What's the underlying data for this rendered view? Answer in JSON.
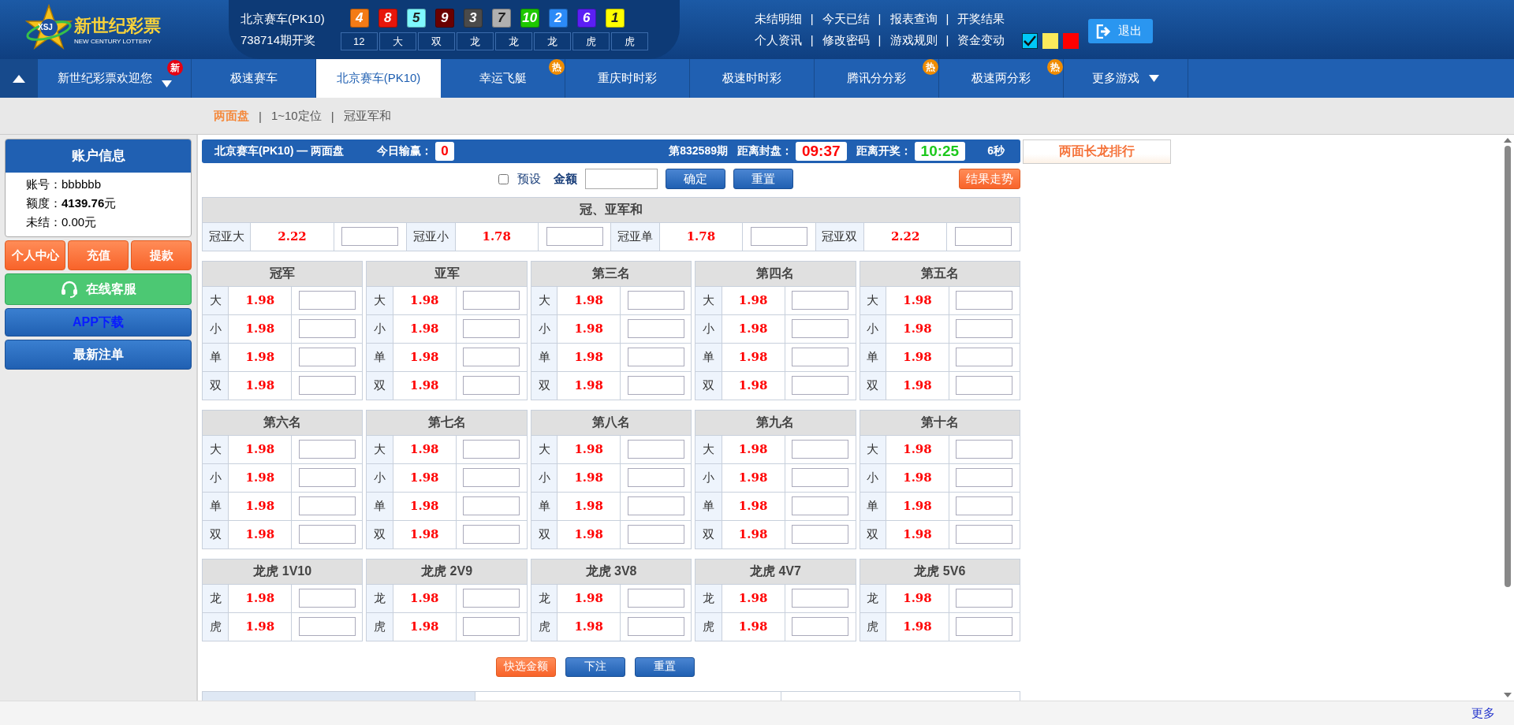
{
  "logo": {
    "title": "新世纪彩票",
    "subtitle": "NEW CENTURY LOTTERY",
    "mark": "XSJ"
  },
  "draw": {
    "game": "北京赛车(PK10)",
    "issue": "738714期开奖",
    "balls": [
      {
        "number": "4",
        "color": "#f47b16"
      },
      {
        "number": "8",
        "color": "#e7160b"
      },
      {
        "number": "5",
        "color": "#7ff8ff"
      },
      {
        "number": "9",
        "color": "#6a0000"
      },
      {
        "number": "3",
        "color": "#4a4a4a"
      },
      {
        "number": "7",
        "color": "#b0b0b0"
      },
      {
        "number": "10",
        "color": "#1ec800"
      },
      {
        "number": "2",
        "color": "#2b8af7"
      },
      {
        "number": "6",
        "color": "#5b1ff5"
      },
      {
        "number": "1",
        "color": "#ffff00"
      }
    ],
    "stats": [
      "12",
      "大",
      "双",
      "龙",
      "龙",
      "龙",
      "虎",
      "虎"
    ]
  },
  "top_links": [
    [
      "未结明细",
      "今天已结",
      "报表查询",
      "开奖结果"
    ],
    [
      "个人资讯",
      "修改密码",
      "游戏规则",
      "资金变动"
    ]
  ],
  "theme_swatches": [
    {
      "color": "#00c8f8",
      "selected": true
    },
    {
      "color": "#fbea5b",
      "selected": false
    },
    {
      "color": "#ff0000",
      "selected": false
    }
  ],
  "link_separator": "|",
  "logout": "退出",
  "nav": [
    {
      "label": "新世纪彩票欢迎您",
      "selected": false,
      "badge": "新",
      "dropdown": true
    },
    {
      "label": "极速赛车",
      "selected": false,
      "dropdown": false
    },
    {
      "label": "北京赛车(PK10)",
      "selected": true,
      "dropdown": false
    },
    {
      "label": "幸运飞艇",
      "selected": false,
      "badge": "热",
      "dropdown": false
    },
    {
      "label": "重庆时时彩",
      "selected": false,
      "dropdown": false
    },
    {
      "label": "极速时时彩",
      "selected": false,
      "dropdown": false
    },
    {
      "label": "腾讯分分彩",
      "selected": false,
      "badge": "热",
      "dropdown": false
    },
    {
      "label": "极速两分彩",
      "selected": false,
      "badge": "热",
      "dropdown": false
    },
    {
      "label": "更多游戏",
      "selected": false,
      "dropdown": true
    }
  ],
  "sub_tab_separator": "|",
  "sub_tabs": [
    {
      "label": "两面盘",
      "selected": true
    },
    {
      "label": "1~10定位",
      "selected": false
    },
    {
      "label": "冠亚军和",
      "selected": false
    }
  ],
  "account": {
    "title": "账户信息",
    "fields": [
      {
        "label": "账号：",
        "value": "bbbbbb",
        "bold": false
      },
      {
        "label": "额度：",
        "value": "4139.76",
        "unit": "元",
        "bold": true
      },
      {
        "label": "未结：",
        "value": "0.00",
        "unit": "元",
        "bold": false
      }
    ]
  },
  "account_buttons": [
    "个人中心",
    "充值",
    "提款"
  ],
  "side_buttons": [
    {
      "label": "在线客服",
      "kind": "green"
    },
    {
      "label": "APP下载",
      "kind": "app"
    },
    {
      "label": "最新注单",
      "kind": "blue"
    }
  ],
  "info_bar": {
    "title": "北京赛车(PK10) — 两面盘",
    "profit_label": "今日输赢：",
    "profit": "0",
    "period": "第832589期",
    "close_label": "距离封盘：",
    "close": "09:37",
    "open_label": "距离开奖：",
    "open": "10:25",
    "refresh": "6秒"
  },
  "ranking": "两面长龙排行",
  "controls": {
    "preset": {
      "label": "预设",
      "checked": false
    },
    "amount_label": "金额",
    "confirm": "确定",
    "reset": "重置",
    "trend": "结果走势"
  },
  "sum_table": {
    "title": "冠、亚军和",
    "items": [
      {
        "label": "冠亚大",
        "odds": "2.22"
      },
      {
        "label": "冠亚小",
        "odds": "1.78"
      },
      {
        "label": "冠亚单",
        "odds": "1.78"
      },
      {
        "label": "冠亚双",
        "odds": "2.22"
      }
    ]
  },
  "groups": [
    {
      "title": "冠军",
      "items": [
        {
          "label": "大",
          "odds": "1.98"
        },
        {
          "label": "小",
          "odds": "1.98"
        },
        {
          "label": "单",
          "odds": "1.98"
        },
        {
          "label": "双",
          "odds": "1.98"
        }
      ]
    },
    {
      "title": "亚军",
      "items": [
        {
          "label": "大",
          "odds": "1.98"
        },
        {
          "label": "小",
          "odds": "1.98"
        },
        {
          "label": "单",
          "odds": "1.98"
        },
        {
          "label": "双",
          "odds": "1.98"
        }
      ]
    },
    {
      "title": "第三名",
      "items": [
        {
          "label": "大",
          "odds": "1.98"
        },
        {
          "label": "小",
          "odds": "1.98"
        },
        {
          "label": "单",
          "odds": "1.98"
        },
        {
          "label": "双",
          "odds": "1.98"
        }
      ]
    },
    {
      "title": "第四名",
      "items": [
        {
          "label": "大",
          "odds": "1.98"
        },
        {
          "label": "小",
          "odds": "1.98"
        },
        {
          "label": "单",
          "odds": "1.98"
        },
        {
          "label": "双",
          "odds": "1.98"
        }
      ]
    },
    {
      "title": "第五名",
      "items": [
        {
          "label": "大",
          "odds": "1.98"
        },
        {
          "label": "小",
          "odds": "1.98"
        },
        {
          "label": "单",
          "odds": "1.98"
        },
        {
          "label": "双",
          "odds": "1.98"
        }
      ]
    },
    {
      "title": "第六名",
      "items": [
        {
          "label": "大",
          "odds": "1.98"
        },
        {
          "label": "小",
          "odds": "1.98"
        },
        {
          "label": "单",
          "odds": "1.98"
        },
        {
          "label": "双",
          "odds": "1.98"
        }
      ]
    },
    {
      "title": "第七名",
      "items": [
        {
          "label": "大",
          "odds": "1.98"
        },
        {
          "label": "小",
          "odds": "1.98"
        },
        {
          "label": "单",
          "odds": "1.98"
        },
        {
          "label": "双",
          "odds": "1.98"
        }
      ]
    },
    {
      "title": "第八名",
      "items": [
        {
          "label": "大",
          "odds": "1.98"
        },
        {
          "label": "小",
          "odds": "1.98"
        },
        {
          "label": "单",
          "odds": "1.98"
        },
        {
          "label": "双",
          "odds": "1.98"
        }
      ]
    },
    {
      "title": "第九名",
      "items": [
        {
          "label": "大",
          "odds": "1.98"
        },
        {
          "label": "小",
          "odds": "1.98"
        },
        {
          "label": "单",
          "odds": "1.98"
        },
        {
          "label": "双",
          "odds": "1.98"
        }
      ]
    },
    {
      "title": "第十名",
      "items": [
        {
          "label": "大",
          "odds": "1.98"
        },
        {
          "label": "小",
          "odds": "1.98"
        },
        {
          "label": "单",
          "odds": "1.98"
        },
        {
          "label": "双",
          "odds": "1.98"
        }
      ]
    },
    {
      "title": "龙虎 1V10",
      "items": [
        {
          "label": "龙",
          "odds": "1.98"
        },
        {
          "label": "虎",
          "odds": "1.98"
        }
      ]
    },
    {
      "title": "龙虎 2V9",
      "items": [
        {
          "label": "龙",
          "odds": "1.98"
        },
        {
          "label": "虎",
          "odds": "1.98"
        }
      ]
    },
    {
      "title": "龙虎 3V8",
      "items": [
        {
          "label": "龙",
          "odds": "1.98"
        },
        {
          "label": "虎",
          "odds": "1.98"
        }
      ]
    },
    {
      "title": "龙虎 4V7",
      "items": [
        {
          "label": "龙",
          "odds": "1.98"
        },
        {
          "label": "虎",
          "odds": "1.98"
        }
      ]
    },
    {
      "title": "龙虎 5V6",
      "items": [
        {
          "label": "龙",
          "odds": "1.98"
        },
        {
          "label": "虎",
          "odds": "1.98"
        }
      ]
    }
  ],
  "bottom_buttons": [
    {
      "label": "快选金额",
      "kind": "orange"
    },
    {
      "label": "下注",
      "kind": "blue"
    },
    {
      "label": "重置",
      "kind": "blue"
    }
  ],
  "footer": "更多"
}
